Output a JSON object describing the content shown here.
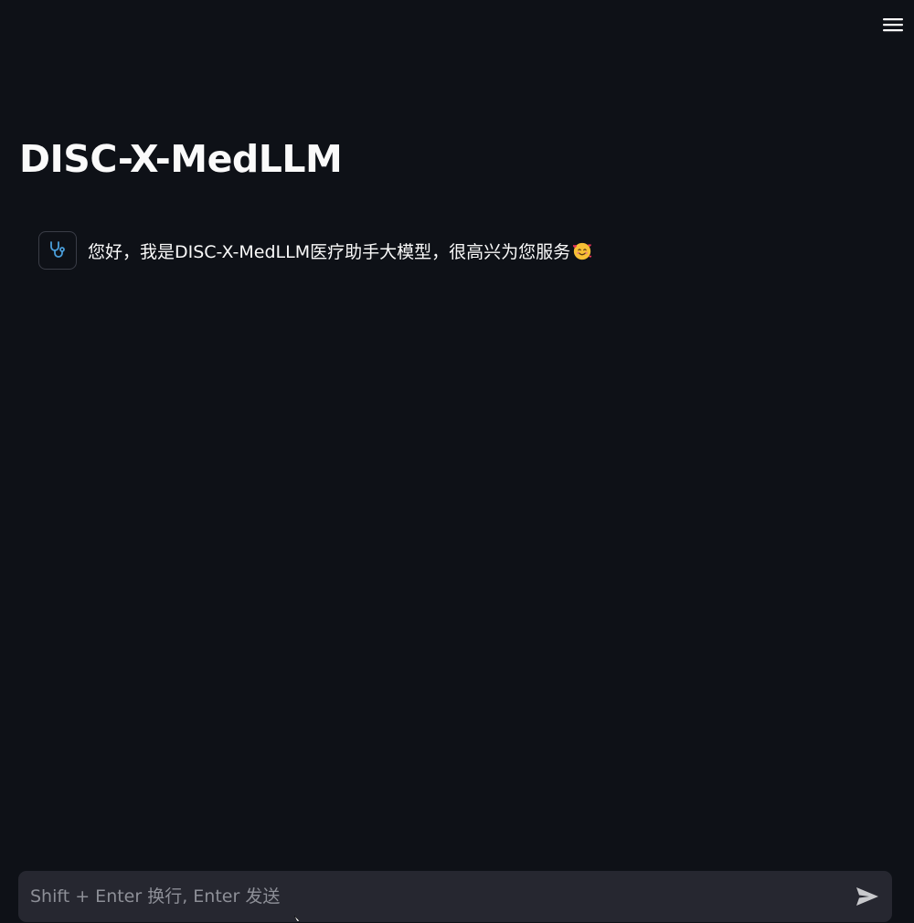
{
  "header": {
    "menu_icon": "hamburger-menu-icon"
  },
  "page": {
    "title": "DISC-X-MedLLM"
  },
  "messages": [
    {
      "role": "assistant",
      "avatar_icon": "stethoscope-icon",
      "text": "您好，我是DISC-X-MedLLM医疗助手大模型，很高兴为您服务",
      "emoji": "smiling-face-with-hearts-emoji"
    }
  ],
  "chat_input": {
    "placeholder": "Shift + Enter 换行, Enter 发送",
    "value": "",
    "send_icon": "send-icon"
  },
  "colors": {
    "background": "#0e1117",
    "input_background": "#262730",
    "text": "#fafafa",
    "placeholder": "#8d8f97",
    "avatar_accent": "#4a9eda"
  }
}
